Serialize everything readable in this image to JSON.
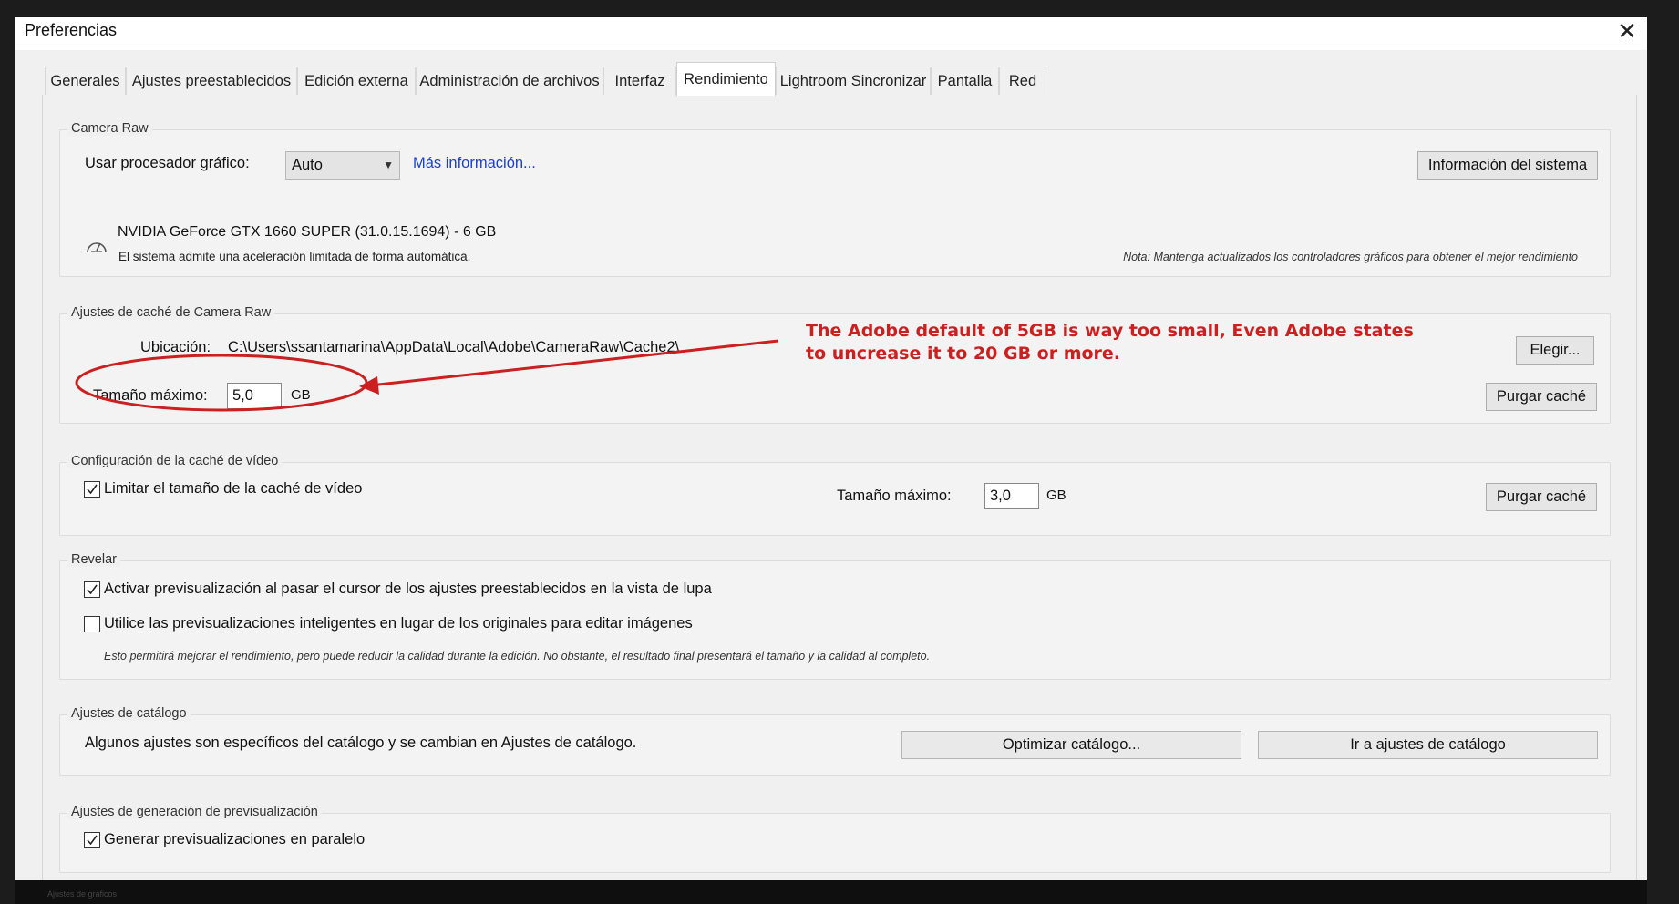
{
  "window": {
    "title": "Preferencias",
    "close_glyph": "✕"
  },
  "tabs": [
    {
      "label": "Generales"
    },
    {
      "label": "Ajustes preestablecidos"
    },
    {
      "label": "Edición externa"
    },
    {
      "label": "Administración de archivos"
    },
    {
      "label": "Interfaz"
    },
    {
      "label": "Rendimiento",
      "active": true
    },
    {
      "label": "Lightroom Sincronizar"
    },
    {
      "label": "Pantalla"
    },
    {
      "label": "Red"
    }
  ],
  "camera_raw": {
    "title": "Camera Raw",
    "gpu_label": "Usar procesador gráfico:",
    "gpu_value": "Auto",
    "more_info_link": "Más información...",
    "system_info_button": "Información del sistema",
    "gpu_name": "NVIDIA GeForce GTX 1660 SUPER (31.0.15.1694) - 6 GB",
    "gpu_note": "El sistema admite una aceleración limitada de forma automática.",
    "driver_note": "Nota: Mantenga actualizados los controladores gráficos para obtener el mejor rendimiento",
    "gauge_icon": "gauge-icon"
  },
  "cache": {
    "title": "Ajustes de caché de Camera Raw",
    "location_label": "Ubicación:",
    "location_value": "C:\\Users\\ssantamarina\\AppData\\Local\\Adobe\\CameraRaw\\Cache2\\",
    "choose_button": "Elegir...",
    "max_size_label": "Tamaño máximo:",
    "max_size_value": "5,0",
    "unit": "GB",
    "purge_button": "Purgar caché"
  },
  "video_cache": {
    "title": "Configuración de la caché de vídeo",
    "limit_label": "Limitar el tamaño de la caché de vídeo",
    "limit_checked": true,
    "max_size_label": "Tamaño máximo:",
    "max_size_value": "3,0",
    "unit": "GB",
    "purge_button": "Purgar caché"
  },
  "develop": {
    "title": "Revelar",
    "hover_preview_label": "Activar previsualización al pasar el cursor de los ajustes preestablecidos en la vista de lupa",
    "hover_preview_checked": true,
    "smart_previews_label": "Utilice las previsualizaciones inteligentes en lugar de los originales para editar imágenes",
    "smart_previews_checked": false,
    "smart_previews_note": "Esto permitirá mejorar el rendimiento, pero puede reducir la calidad durante la edición. No obstante, el resultado final presentará el tamaño y la calidad al completo."
  },
  "catalog": {
    "title": "Ajustes de catálogo",
    "description": "Algunos ajustes son específicos del catálogo y se cambian en Ajustes de catálogo.",
    "optimize_button": "Optimizar catálogo...",
    "go_settings_button": "Ir a ajustes de catálogo"
  },
  "preview_gen": {
    "title": "Ajustes de generación de previsualización",
    "parallel_label": "Generar previsualizaciones en paralelo",
    "parallel_checked": true
  },
  "annotation": {
    "line1": "The Adobe default of 5GB is way too small, Even Adobe states",
    "line2": "to uncrease it to 20 GB or more.",
    "color": "#cc1f1f"
  },
  "footer": {
    "hidden_text": "Ajustes de gráficos"
  }
}
